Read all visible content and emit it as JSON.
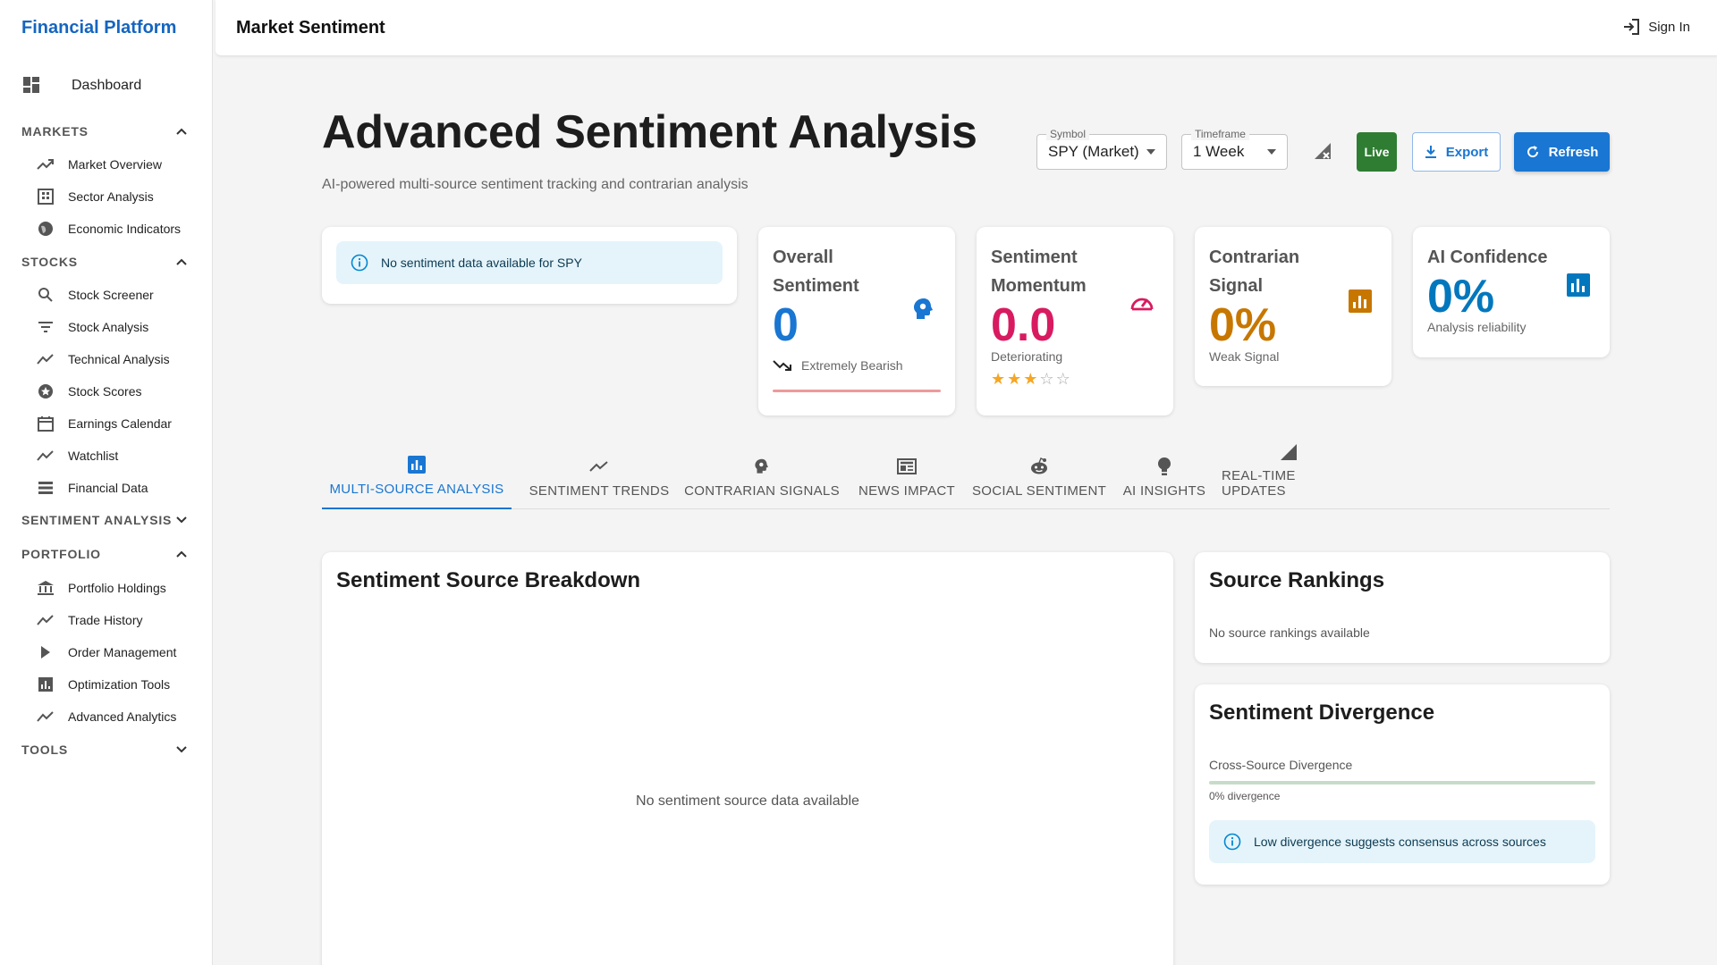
{
  "sidebar": {
    "brand": "Financial Platform",
    "dashboard_label": "Dashboard",
    "sections": {
      "markets": "MARKETS",
      "stocks": "STOCKS",
      "sentiment": "SENTIMENT ANALYSIS",
      "portfolio": "PORTFOLIO",
      "tools": "TOOLS"
    },
    "markets_items": [
      "Market Overview",
      "Sector Analysis",
      "Economic Indicators"
    ],
    "stocks_items": [
      "Stock Screener",
      "Stock Analysis",
      "Technical Analysis",
      "Stock Scores",
      "Earnings Calendar",
      "Watchlist",
      "Financial Data"
    ],
    "portfolio_items": [
      "Portfolio Holdings",
      "Trade History",
      "Order Management",
      "Optimization Tools",
      "Advanced Analytics"
    ]
  },
  "topbar": {
    "title": "Market Sentiment",
    "signin_label": "Sign In"
  },
  "header": {
    "title": "Advanced Sentiment Analysis",
    "subtitle": "AI-powered multi-source sentiment tracking and contrarian analysis",
    "symbol_legend": "Symbol",
    "symbol_value": "SPY (Market)",
    "timeframe_legend": "Timeframe",
    "timeframe_value": "1 Week",
    "live_label": "Live",
    "export_label": "Export",
    "refresh_label": "Refresh"
  },
  "alert": {
    "text": "No sentiment data available for SPY"
  },
  "metrics": {
    "overall": {
      "label": "Overall Sentiment",
      "value": "0",
      "sub": "Extremely Bearish",
      "color": "#1976d2"
    },
    "momentum": {
      "label": "Sentiment Momentum",
      "value": "0.0",
      "sub": "Deteriorating",
      "rating": 3,
      "rating_max": 5,
      "color": "#d81b60"
    },
    "contrarian": {
      "label": "Contrarian Signal",
      "value": "0%",
      "sub": "Weak Signal",
      "color": "#c77700"
    },
    "confidence": {
      "label": "AI Confidence",
      "value": "0%",
      "sub": "Analysis reliability",
      "color": "#0277bd"
    }
  },
  "tabs": [
    "MULTI-SOURCE ANALYSIS",
    "SENTIMENT TRENDS",
    "CONTRARIAN SIGNALS",
    "NEWS IMPACT",
    "SOCIAL SENTIMENT",
    "AI INSIGHTS",
    "REAL-TIME UPDATES"
  ],
  "breakdown": {
    "title": "Sentiment Source Breakdown",
    "empty": "No sentiment source data available"
  },
  "rankings": {
    "title": "Source Rankings",
    "empty": "No source rankings available"
  },
  "divergence": {
    "title": "Sentiment Divergence",
    "metric_label": "Cross-Source Divergence",
    "value": 0,
    "value_label": "0% divergence",
    "note": "Low divergence suggests consensus across sources"
  },
  "colors": {
    "primary": "#1976d2",
    "brand": "#1565c0",
    "success": "#2e7d32"
  }
}
